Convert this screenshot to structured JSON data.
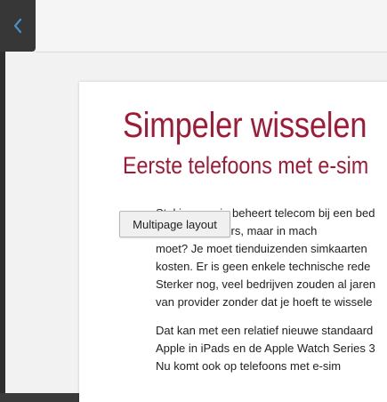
{
  "nav": {
    "back_icon": "chevron-left-icon"
  },
  "article": {
    "title": "Simpeler wisselen",
    "subtitle": "Eerste telefoons met e-sim",
    "paragraphs": [
      {
        "lines": [
          "Stel je voor: je beheert telecom bij een bed",
          "tig medewerkers, maar in mach",
          "moet? Je moet tienduizenden simkaarten",
          "kosten. Er is geen enkele technische rede",
          "Sterker nog, veel bedrijven zouden al jaren",
          "van provider zonder dat je hoeft te wissele"
        ]
      },
      {
        "lines": [
          "Dat kan met een relatief nieuwe standaard",
          "Apple in iPads en de Apple Watch Series 3",
          "Nu komt ook op telefoons met e-sim"
        ]
      }
    ]
  },
  "overlay_button": {
    "label": "Multipage layout"
  }
}
